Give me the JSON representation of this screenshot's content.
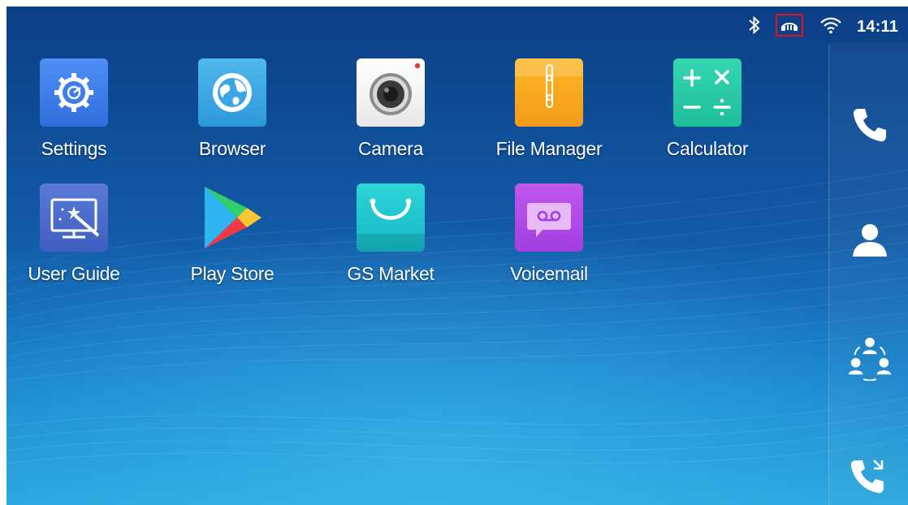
{
  "status_bar": {
    "time": "14:11",
    "icons": [
      "bluetooth-icon",
      "headset-icon",
      "wifi-icon"
    ],
    "highlight_color": "#e5121b"
  },
  "apps": [
    {
      "label": "Settings",
      "icon": "settings-gear-icon"
    },
    {
      "label": "Browser",
      "icon": "globe-icon"
    },
    {
      "label": "Camera",
      "icon": "camera-lens-icon"
    },
    {
      "label": "File Manager",
      "icon": "folder-zip-icon"
    },
    {
      "label": "Calculator",
      "icon": "calculator-icon"
    },
    {
      "label": "User Guide",
      "icon": "screen-magic-wand-icon"
    },
    {
      "label": "Play Store",
      "icon": "play-triangle-icon"
    },
    {
      "label": "GS Market",
      "icon": "shopping-bag-icon"
    },
    {
      "label": "Voicemail",
      "icon": "voicemail-icon"
    }
  ],
  "dock": [
    "phone-icon",
    "contacts-icon",
    "conference-icon",
    "call-history-icon"
  ],
  "colors": {
    "wallpaper_top": "#0c3f86",
    "wallpaper_bottom": "#2aa6de",
    "text": "#ffffff"
  }
}
